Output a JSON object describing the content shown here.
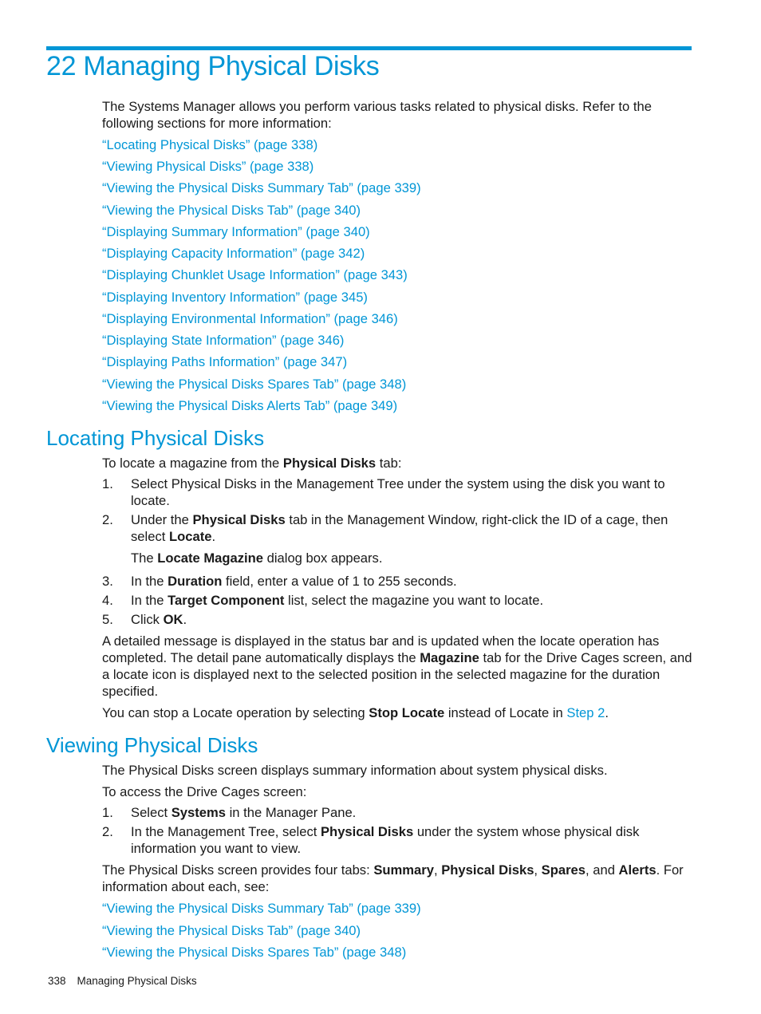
{
  "chapter": {
    "number": "22",
    "title": "Managing Physical Disks"
  },
  "intro": "The Systems Manager allows you perform various tasks related to physical disks. Refer to the following sections for more information:",
  "toc_links": [
    "“Locating Physical Disks” (page 338)",
    "“Viewing Physical Disks” (page 338)",
    "“Viewing the Physical Disks Summary Tab” (page 339)",
    "“Viewing the Physical Disks Tab” (page 340)",
    "“Displaying Summary Information” (page 340)",
    "“Displaying Capacity Information” (page 342)",
    "“Displaying Chunklet Usage Information” (page 343)",
    "“Displaying Inventory Information” (page 345)",
    "“Displaying Environmental Information” (page 346)",
    "“Displaying State Information” (page 346)",
    "“Displaying Paths Information” (page 347)",
    "“Viewing the Physical Disks Spares Tab” (page 348)",
    "“Viewing the Physical Disks Alerts Tab” (page 349)"
  ],
  "locating": {
    "heading": "Locating Physical Disks",
    "lead": {
      "pre": "To locate a magazine from the ",
      "bold": "Physical Disks",
      "post": " tab:"
    },
    "steps": [
      {
        "num": "1.",
        "text": "Select Physical Disks in the Management Tree under the system using the disk you want to locate."
      },
      {
        "num": "2.",
        "pre": "Under the ",
        "bold1": "Physical Disks",
        "mid": " tab in the Management Window, right-click the ID of a cage, then select ",
        "bold2": "Locate",
        "post": "."
      },
      {
        "num": "3.",
        "pre": "In the ",
        "bold": "Duration",
        "post": " field, enter a value of 1 to 255 seconds."
      },
      {
        "num": "4.",
        "pre": "In the ",
        "bold": "Target Component",
        "post": " list, select the magazine you want to locate."
      },
      {
        "num": "5.",
        "pre": "Click ",
        "bold": "OK",
        "post": "."
      }
    ],
    "step2_note": {
      "pre": "The ",
      "bold": "Locate Magazine",
      "post": " dialog box appears."
    },
    "detail": {
      "pre": "A detailed message is displayed in the status bar and is updated when the locate operation has completed. The detail pane automatically displays the ",
      "bold": "Magazine",
      "post": " tab for the Drive Cages screen, and a locate icon is displayed next to the selected position in the selected magazine for the duration specified."
    },
    "stop": {
      "pre": "You can stop a Locate operation by selecting ",
      "bold": "Stop Locate",
      "mid": " instead of Locate in ",
      "link": "Step 2",
      "post": "."
    }
  },
  "viewing": {
    "heading": "Viewing Physical Disks",
    "p1": "The Physical Disks screen displays summary information about system physical disks.",
    "p2": "To access the Drive Cages screen:",
    "steps": [
      {
        "num": "1.",
        "pre": "Select ",
        "bold": "Systems",
        "post": " in the Manager Pane."
      },
      {
        "num": "2.",
        "pre": "In the Management Tree, select ",
        "bold": "Physical Disks",
        "post": " under the system whose physical disk information you want to view."
      }
    ],
    "tabs_para": {
      "pre": "The Physical Disks screen provides four tabs: ",
      "t1": "Summary",
      "s1": ", ",
      "t2": "Physical Disks",
      "s2": ", ",
      "t3": "Spares",
      "s3": ", and ",
      "t4": "Alerts",
      "post": ". For information about each, see:"
    },
    "links": [
      "“Viewing the Physical Disks Summary Tab” (page 339)",
      "“Viewing the Physical Disks Tab” (page 340)",
      "“Viewing the Physical Disks Spares Tab” (page 348)"
    ]
  },
  "footer": {
    "page": "338",
    "title": "Managing Physical Disks"
  },
  "colors": {
    "accent": "#0096d6",
    "text": "#1a1a1a"
  }
}
